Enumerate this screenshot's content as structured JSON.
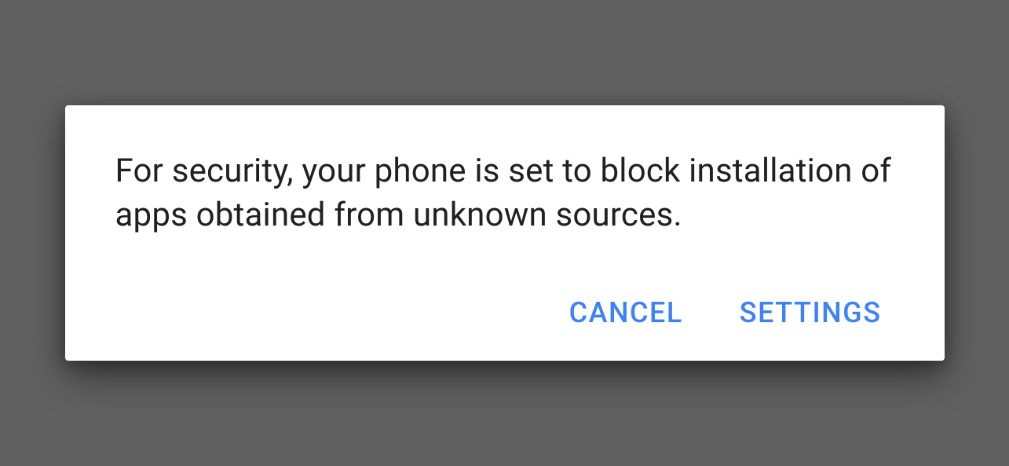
{
  "dialog": {
    "message": "For security, your phone is set to block installation of apps obtained from unknown sources.",
    "actions": {
      "cancel": "CANCEL",
      "settings": "SETTINGS"
    }
  }
}
